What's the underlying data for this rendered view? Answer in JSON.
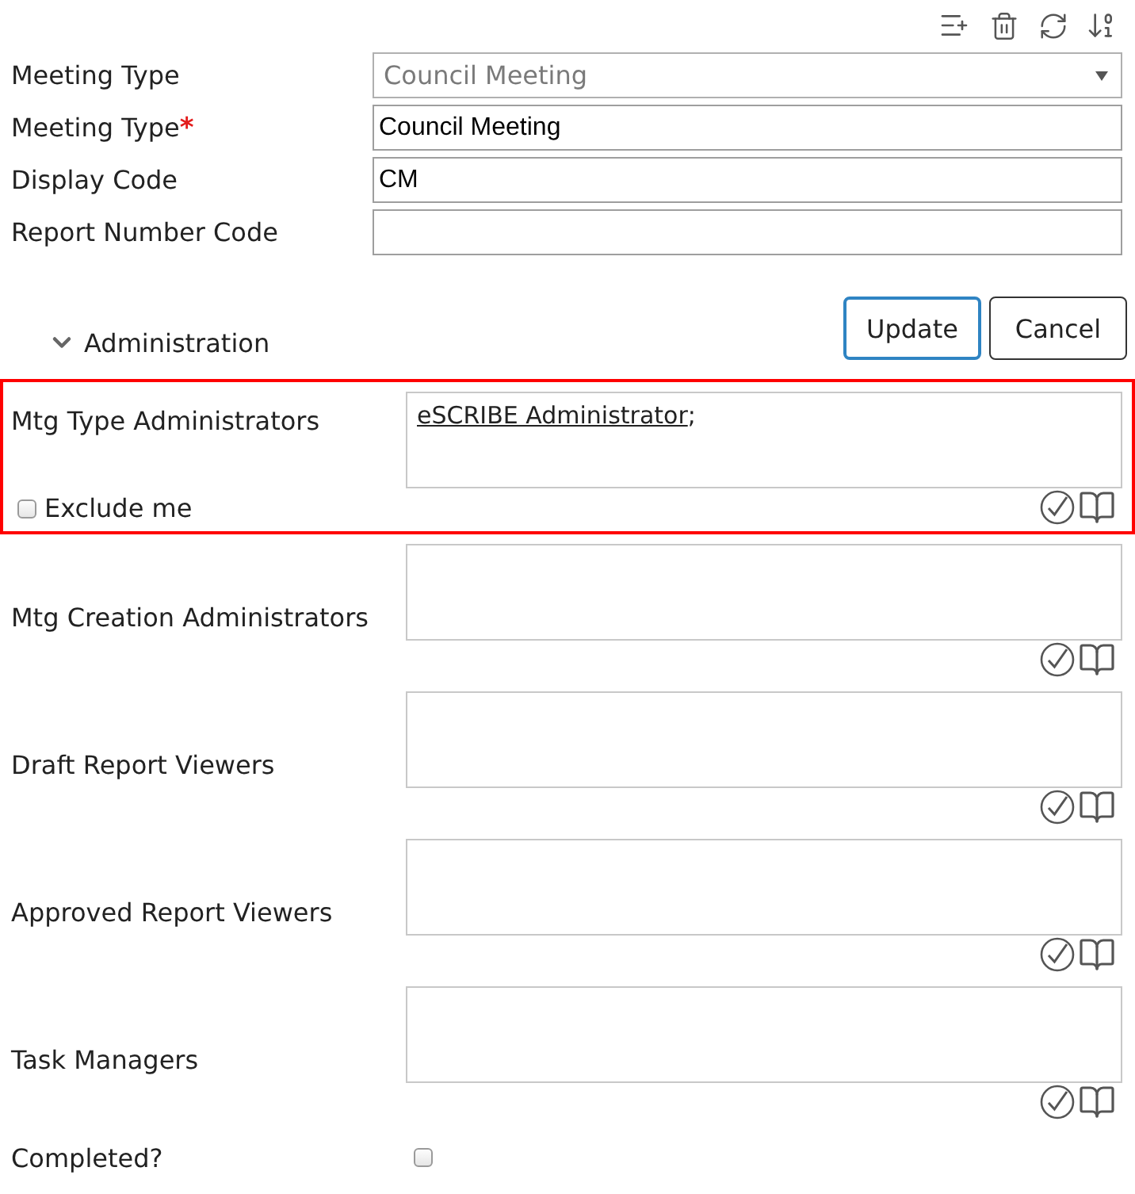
{
  "fields": [
    {
      "kind": "select",
      "label": "Meeting Type",
      "value": "Council Meeting",
      "disabled": true
    },
    {
      "kind": "text",
      "label": "Meeting Type",
      "required_mark": "*",
      "value": "Council Meeting",
      "disabled": false
    },
    {
      "kind": "text",
      "label": "Display Code",
      "value": "CM",
      "disabled": false
    },
    {
      "kind": "text",
      "label": "Report Number Code",
      "disabled": false
    }
  ],
  "administration": {
    "label": "Administration",
    "expanded": true
  },
  "buttons": [
    {
      "label": "Update",
      "focused": true
    },
    {
      "label": "Cancel",
      "focused": false
    }
  ],
  "people_fields": [
    {
      "label": "Mtg Type Administrators",
      "highlighted": true,
      "entries": [
        {
          "name": "eSCRIBE Administrator",
          "separator": ";"
        }
      ],
      "exclude_me": {
        "label": "Exclude me",
        "checked": false
      }
    },
    {
      "label": "Mtg Creation Administrators",
      "highlighted": false
    },
    {
      "label": "Draft Report Viewers",
      "highlighted": false
    },
    {
      "label": "Approved Report Viewers",
      "highlighted": false
    },
    {
      "label": "Task Managers",
      "highlighted": false
    }
  ],
  "completed": {
    "label": "Completed?",
    "checked": false
  }
}
